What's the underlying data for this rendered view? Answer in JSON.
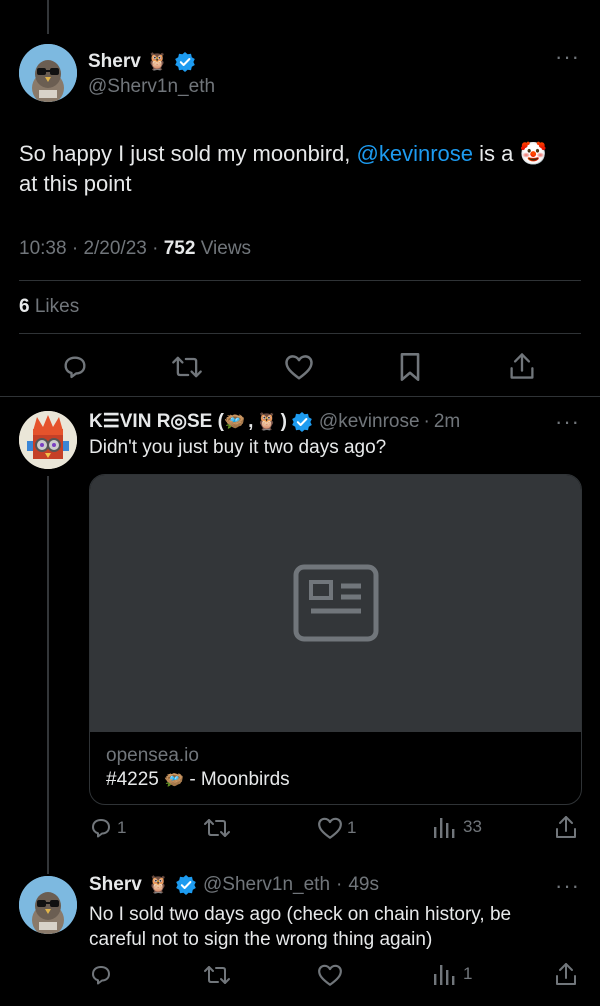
{
  "main_tweet": {
    "display_name": "Sherv",
    "owl_emoji": "🦉",
    "handle": "@Sherv1n_eth",
    "text_before_mention": "So happy I just sold my moonbird, ",
    "mention": "@kevinrose",
    "text_after_mention": " is a ",
    "clown_emoji": "🤡",
    "text_line2": "at this point",
    "time": "10:38",
    "dot": "·",
    "date": "2/20/23",
    "views_count": "752",
    "views_label": "Views",
    "likes_count": "6",
    "likes_label": "Likes"
  },
  "reply1": {
    "display_name": "K☰VIN R◎SE (",
    "emoji_nest": "🪺",
    "comma": ",",
    "emoji_owl": "🦉",
    "close_paren": ")",
    "handle": "@kevinrose",
    "dot": "·",
    "age": "2m",
    "text": "Didn't you just buy it two days ago?",
    "card_domain": "opensea.io",
    "card_title_prefix": "#4225",
    "card_emoji": "🪺",
    "card_title_suffix": "- Moonbirds",
    "reply_count": "1",
    "like_count": "1",
    "views_count": "33"
  },
  "reply2": {
    "display_name": "Sherv",
    "owl_emoji": "🦉",
    "handle": "@Sherv1n_eth",
    "dot": "·",
    "age": "49s",
    "text_line1": "No I sold two days ago (check on chain history, be",
    "text_line2": "careful not to sign the wrong thing again)",
    "views_count": "1"
  },
  "colors": {
    "background": "#000000",
    "text": "#e7e9ea",
    "muted": "#71767b",
    "accent": "#1d9bf0",
    "divider": "#2f3336",
    "card_image_bg": "#333639"
  }
}
